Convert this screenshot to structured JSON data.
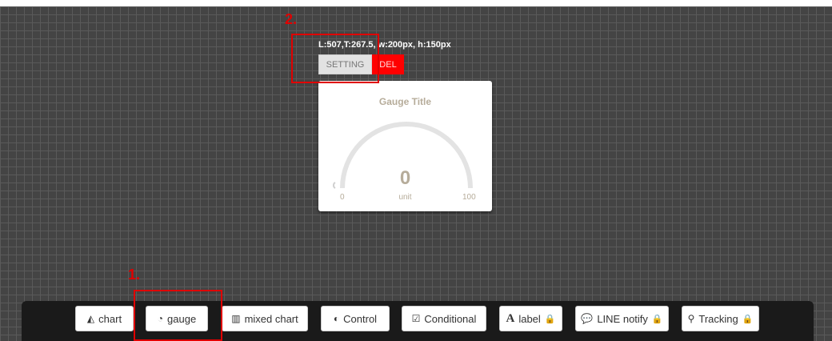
{
  "widget": {
    "position_info": "L:507,T:267.5, w:200px, h:150px",
    "setting_label": "SETTING",
    "delete_label": "DEL"
  },
  "gauge": {
    "title": "Gauge Title",
    "value": "0",
    "unit": "unit",
    "min": "0",
    "max": "100",
    "level_fraction": 0
  },
  "annotations": {
    "step1": "1.",
    "step2": "2."
  },
  "toolbar": {
    "items": [
      {
        "label": "chart",
        "icon": "area-chart-icon"
      },
      {
        "label": "gauge",
        "icon": "dashboard-icon"
      },
      {
        "label": "mixed chart",
        "icon": "bar-chart-icon"
      },
      {
        "label": "Control",
        "icon": "toggle-icon"
      },
      {
        "label": "Conditional",
        "icon": "checkbox-icon"
      },
      {
        "label": "label",
        "icon": "font-icon",
        "locked": true
      },
      {
        "label": "LINE notify",
        "icon": "chat-bubble-icon",
        "locked": true
      },
      {
        "label": "Tracking",
        "icon": "map-marker-icon",
        "locked": true
      }
    ]
  },
  "colors": {
    "canvas": "#444444",
    "delete": "#ff0000",
    "annotation": "#e00000",
    "gauge_text": "#b6ac9a",
    "toolbar": "#1a1a1a"
  }
}
